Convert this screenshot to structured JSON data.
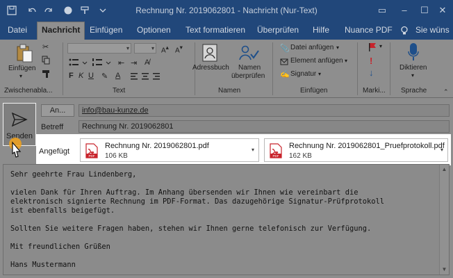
{
  "window": {
    "title": "Rechnung Nr. 2019062801  -  Nachricht (Nur-Text)",
    "controls": [
      "restore",
      "minimize",
      "maximize",
      "close"
    ]
  },
  "tabs": [
    {
      "label": "Datei"
    },
    {
      "label": "Nachricht"
    },
    {
      "label": "Einfügen"
    },
    {
      "label": "Optionen"
    },
    {
      "label": "Text formatieren"
    },
    {
      "label": "Überprüfen"
    },
    {
      "label": "Hilfe"
    },
    {
      "label": "Nuance PDF"
    }
  ],
  "tellme": "Sie wüns",
  "ribbon": {
    "clipboard": {
      "paste_label": "Einfügen",
      "group_label": "Zwischenabla..."
    },
    "text": {
      "group_label": "Text"
    },
    "names": {
      "addressbook_label": "Adressbuch",
      "checknames_line1": "Namen",
      "checknames_line2": "überprüfen",
      "group_label": "Namen"
    },
    "insert": {
      "attach_file_label": "Datei anfügen",
      "attach_item_label": "Element anfügen",
      "signature_label": "Signatur",
      "group_label": "Einfügen"
    },
    "tags": {
      "group_label": "Marki..."
    },
    "speech": {
      "dictate_label": "Diktieren",
      "group_label": "Sprache"
    }
  },
  "compose": {
    "send_label": "Senden",
    "to_button_label": "An...",
    "to_value": "info@bau-kunze.de",
    "subject_label": "Betreff",
    "subject_value": "Rechnung Nr. 2019062801",
    "attached_label": "Angefügt",
    "attachments": [
      {
        "name": "Rechnung Nr. 2019062801.pdf",
        "size": "106 KB"
      },
      {
        "name": "Rechnung Nr. 2019062801_Pruefprotokoll.pdf",
        "size": "162 KB"
      }
    ],
    "body": "Sehr geehrte Frau Lindenberg,\n\nvielen Dank für Ihren Auftrag. Im Anhang übersenden wir Ihnen wie vereinbart die\nelektronisch signierte Rechnung im PDF-Format. Das dazugehörige Signatur-Prüfprotokoll\nist ebenfalls beigefügt.\n\nSollten Sie weitere Fragen haben, stehen wir Ihnen gerne telefonisch zur Verfügung.\n\nMit freundlichen Grüßen\n\nHans Mustermann"
  },
  "colors": {
    "titlebar": "#21477a",
    "ribbon": "#8e8e8e",
    "compose": "#8d8d8d",
    "attach_highlight": "#ffffff",
    "pdf_red": "#c8232b"
  }
}
